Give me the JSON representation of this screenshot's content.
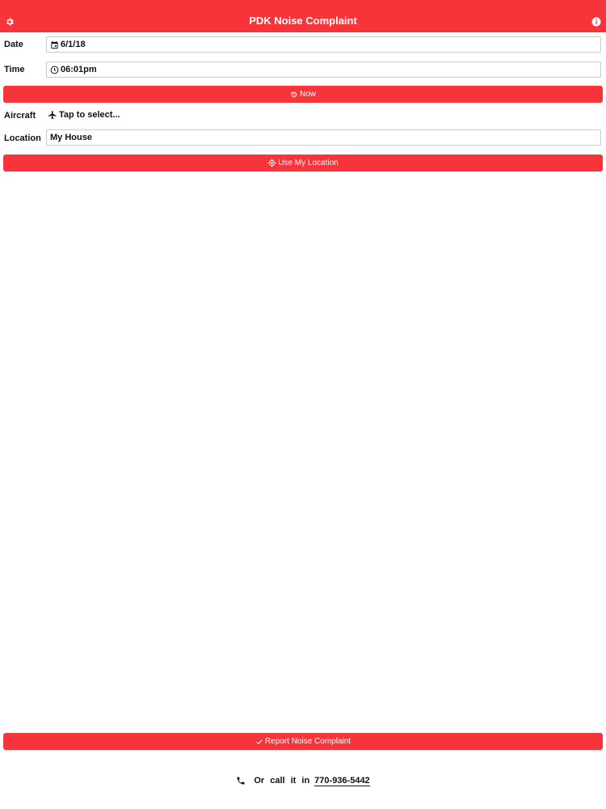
{
  "header": {
    "title": "PDK Noise Complaint"
  },
  "form": {
    "date": {
      "label": "Date",
      "value": "6/1/18"
    },
    "time": {
      "label": "Time",
      "value": "06:01pm"
    },
    "now_button": "Now",
    "aircraft": {
      "label": "Aircraft",
      "value": "Tap to select..."
    },
    "location": {
      "label": "Location",
      "value": "My House"
    },
    "use_location_button": "Use My Location"
  },
  "report_button": "Report Noise Complaint",
  "footer": {
    "text": "Or call it in",
    "phone": "770-936-5442"
  },
  "colors": {
    "accent": "#f8343b",
    "text": "#111111",
    "border": "#c9c9c9"
  },
  "icons": [
    "gear-icon",
    "info-icon",
    "calendar-icon",
    "clock-icon",
    "history-icon",
    "airplane-icon",
    "crosshair-icon",
    "check-icon",
    "phone-icon"
  ]
}
